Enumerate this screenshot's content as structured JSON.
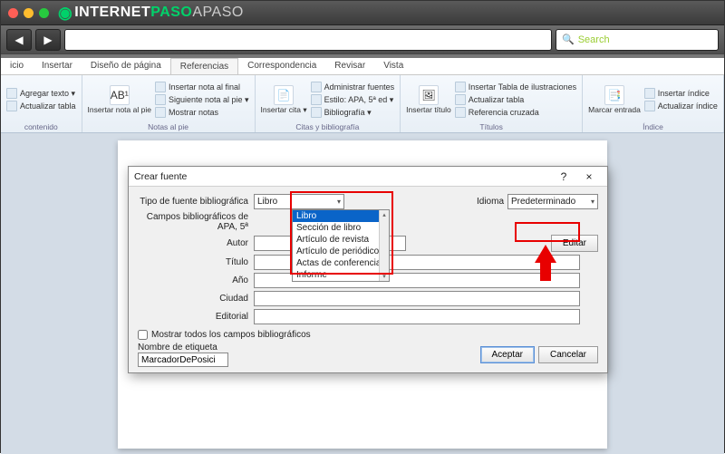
{
  "browser": {
    "brand_prefix": "INTERNET",
    "brand_mid": "PASO",
    "brand_suffix": "APASO",
    "search_placeholder": "Search"
  },
  "tabs": {
    "items": [
      "icio",
      "Insertar",
      "Diseño de página",
      "Referencias",
      "Correspondencia",
      "Revisar",
      "Vista"
    ],
    "active_index": 3
  },
  "ribbon": {
    "g0": {
      "label": "contenido",
      "items": [
        "Agregar texto ▾",
        "Actualizar tabla"
      ]
    },
    "g1": {
      "label": "Notas al pie",
      "big": "Insertar nota al pie",
      "items": [
        "Insertar nota al final",
        "Siguiente nota al pie ▾",
        "Mostrar notas"
      ]
    },
    "g2": {
      "label": "Citas y bibliografía",
      "big": "Insertar cita ▾",
      "items": [
        "Administrar fuentes",
        "Estilo: APA, 5ª ed ▾",
        "Bibliografía ▾"
      ]
    },
    "g3": {
      "label": "Títulos",
      "big": "Insertar título",
      "items": [
        "Insertar Tabla de ilustraciones",
        "Actualizar tabla",
        "Referencia cruzada"
      ]
    },
    "g4": {
      "label": "Índice",
      "big": "Marcar entrada",
      "items": [
        "Insertar índice",
        "Actualizar índice"
      ]
    }
  },
  "dialog": {
    "title": "Crear fuente",
    "help_char": "?",
    "close_char": "×",
    "type_label": "Tipo de fuente bibliográfica",
    "type_value": "Libro",
    "fields_label": "Campos bibliográficos de APA, 5ª",
    "lang_label": "Idioma",
    "lang_value": "Predeterminado",
    "row_autor": "Autor",
    "row_titulo": "Título",
    "row_ano": "Año",
    "row_ciudad": "Ciudad",
    "row_editorial": "Editorial",
    "editar_btn": "Editar",
    "show_all": "Mostrar todos los campos bibliográficos",
    "tag_label": "Nombre de etiqueta",
    "tag_value": "MarcadorDePosici",
    "ok": "Aceptar",
    "cancel": "Cancelar",
    "options": [
      "Libro",
      "Sección de libro",
      "Artículo de revista",
      "Artículo de periódico",
      "Actas de conferencia",
      "Informe"
    ]
  }
}
